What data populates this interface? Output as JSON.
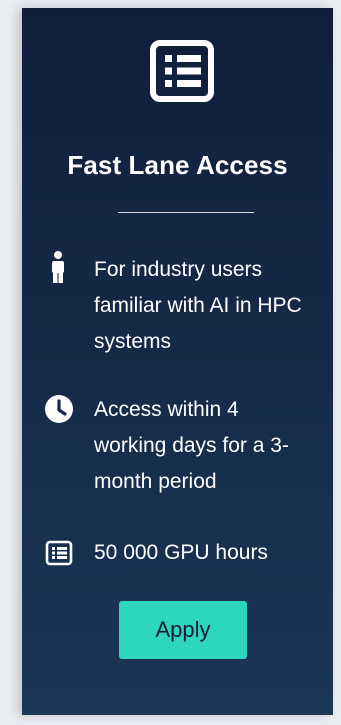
{
  "card": {
    "header_icon": "list-icon",
    "title": "Fast Lane Access",
    "features": [
      {
        "icon": "person-icon",
        "text": "For industry users familiar with AI in HPC systems"
      },
      {
        "icon": "clock-icon",
        "text": "Access within 4 working days for a 3-month period"
      },
      {
        "icon": "list-icon",
        "text": "50 000 GPU hours"
      }
    ],
    "apply_label": "Apply"
  },
  "colors": {
    "background_top": "#0f1f3a",
    "background_bottom": "#1c3658",
    "accent": "#2fd6be"
  }
}
